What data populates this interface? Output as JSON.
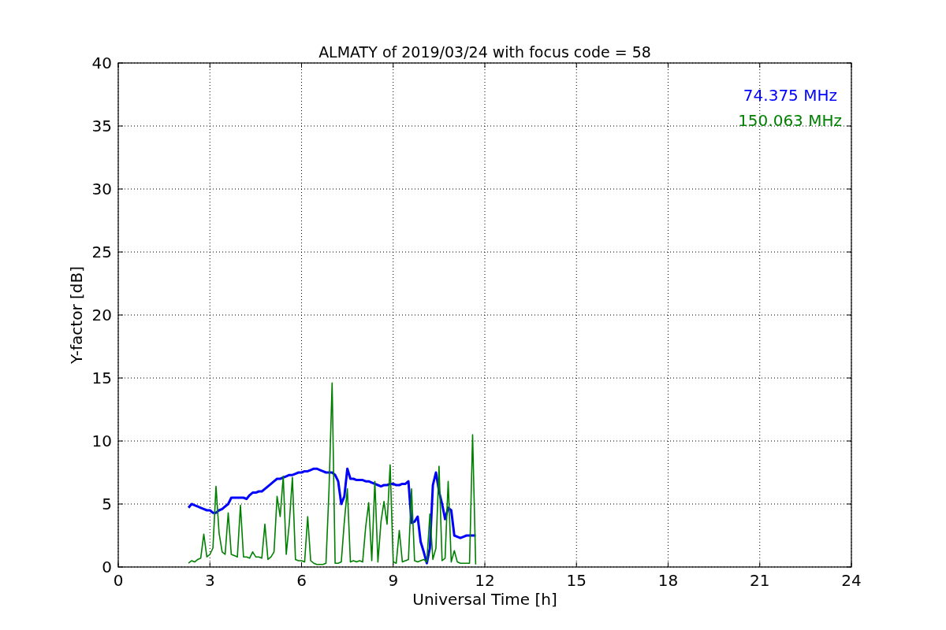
{
  "chart_data": {
    "type": "line",
    "title": "ALMATY of 2019/03/24 with focus code = 58",
    "xlabel": "Universal Time [h]",
    "ylabel": "Y-factor [dB]",
    "x": [
      2.3,
      2.4,
      2.5,
      2.6,
      2.7,
      2.8,
      2.9,
      3.0,
      3.1,
      3.2,
      3.3,
      3.4,
      3.5,
      3.6,
      3.7,
      3.8,
      3.9,
      4.0,
      4.1,
      4.2,
      4.3,
      4.4,
      4.5,
      4.6,
      4.7,
      4.8,
      4.9,
      5.0,
      5.1,
      5.2,
      5.3,
      5.4,
      5.5,
      5.6,
      5.7,
      5.8,
      5.9,
      6.0,
      6.1,
      6.2,
      6.3,
      6.4,
      6.5,
      6.6,
      6.7,
      6.8,
      6.9,
      7.0,
      7.1,
      7.2,
      7.3,
      7.4,
      7.5,
      7.6,
      7.7,
      7.8,
      7.9,
      8.0,
      8.1,
      8.2,
      8.3,
      8.4,
      8.5,
      8.6,
      8.7,
      8.8,
      8.9,
      9.0,
      9.1,
      9.2,
      9.3,
      9.4,
      9.5,
      9.6,
      9.7,
      9.8,
      9.9,
      10.0,
      10.1,
      10.2,
      10.3,
      10.4,
      10.5,
      10.6,
      10.7,
      10.8,
      10.9,
      11.0,
      11.1,
      11.2,
      11.3,
      11.4,
      11.5,
      11.6,
      11.7
    ],
    "series": [
      {
        "name": "74.375 MHz",
        "color": "#0000ff",
        "values": [
          4.7,
          5.0,
          4.9,
          4.8,
          4.7,
          4.6,
          4.5,
          4.5,
          4.3,
          4.3,
          4.5,
          4.6,
          4.8,
          5.0,
          5.5,
          5.5,
          5.5,
          5.5,
          5.5,
          5.4,
          5.7,
          5.9,
          5.9,
          6.0,
          6.0,
          6.2,
          6.4,
          6.6,
          6.8,
          7.0,
          7.0,
          7.1,
          7.2,
          7.3,
          7.3,
          7.4,
          7.5,
          7.5,
          7.6,
          7.6,
          7.7,
          7.8,
          7.8,
          7.7,
          7.6,
          7.5,
          7.5,
          7.5,
          7.3,
          6.8,
          5.0,
          5.6,
          7.8,
          7.0,
          7.0,
          6.9,
          6.9,
          6.9,
          6.8,
          6.8,
          6.7,
          6.6,
          6.5,
          6.4,
          6.5,
          6.5,
          6.6,
          6.6,
          6.5,
          6.5,
          6.6,
          6.6,
          6.8,
          3.5,
          3.6,
          4.0,
          2.0,
          1.2,
          0.3,
          1.5,
          6.5,
          7.5,
          6.0,
          5.0,
          3.8,
          4.7,
          4.5,
          2.5,
          2.4,
          2.3,
          2.4,
          2.5,
          2.5,
          2.5,
          2.5
        ]
      },
      {
        "name": "150.063 MHz",
        "color": "#008000",
        "values": [
          0.3,
          0.5,
          0.4,
          0.6,
          0.7,
          2.6,
          0.8,
          1.0,
          1.5,
          6.4,
          2.7,
          1.2,
          1.0,
          4.3,
          1.0,
          0.9,
          0.8,
          4.9,
          0.8,
          0.8,
          0.7,
          1.2,
          0.8,
          0.8,
          0.7,
          3.4,
          0.6,
          0.8,
          1.2,
          5.6,
          4.0,
          7.2,
          1.0,
          3.5,
          7.1,
          0.6,
          0.5,
          0.5,
          0.4,
          4.0,
          0.5,
          0.3,
          0.2,
          0.2,
          0.2,
          0.3,
          6.2,
          14.6,
          0.3,
          0.3,
          0.4,
          3.6,
          6.2,
          0.4,
          0.5,
          0.4,
          0.5,
          0.4,
          3.2,
          5.1,
          0.5,
          6.8,
          0.4,
          3.6,
          5.2,
          3.4,
          8.1,
          0.4,
          0.3,
          2.9,
          0.4,
          0.5,
          0.6,
          6.2,
          0.5,
          0.4,
          0.5,
          0.6,
          0.4,
          4.2,
          0.6,
          1.5,
          8.0,
          0.5,
          0.7,
          6.8,
          0.4,
          1.3,
          0.4,
          0.3,
          0.3,
          0.3,
          0.3,
          10.5,
          0.2
        ]
      }
    ],
    "grid": true,
    "xlim": [
      0,
      24
    ],
    "ylim": [
      0,
      40
    ],
    "xticks": [
      0,
      3,
      6,
      9,
      12,
      15,
      18,
      21,
      24
    ],
    "yticks": [
      0,
      5,
      10,
      15,
      20,
      25,
      30,
      35,
      40
    ]
  }
}
